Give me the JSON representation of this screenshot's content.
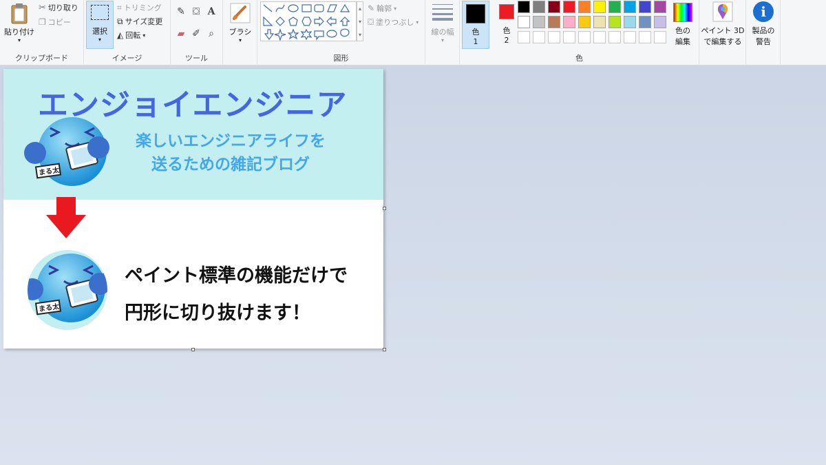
{
  "ribbon": {
    "clipboard": {
      "paste_label": "貼り付け",
      "cut_label": "切り取り",
      "copy_label": "コピー",
      "group_label": "クリップボード"
    },
    "image": {
      "select_label": "選択",
      "crop_label": "トリミング",
      "resize_label": "サイズ変更",
      "rotate_label": "回転",
      "group_label": "イメージ"
    },
    "tools": {
      "group_label": "ツール"
    },
    "brushes": {
      "label": "ブラシ"
    },
    "shapes": {
      "outline_label": "輪郭",
      "fill_label": "塗りつぶし",
      "group_label": "図形"
    },
    "size": {
      "label": "線の幅"
    },
    "colors": {
      "color1_label": "色",
      "color1_num": "1",
      "color2_label": "色",
      "color2_num": "2",
      "color1_value": "#000000",
      "color2_value": "#ed1c24",
      "edit_label_1": "色の",
      "edit_label_2": "編集",
      "group_label": "色",
      "palette_row1": [
        "#000000",
        "#7f7f7f",
        "#880015",
        "#ed1c24",
        "#ff7f27",
        "#fff200",
        "#22b14c",
        "#00a2e8",
        "#3f48cc",
        "#a349a4"
      ],
      "palette_row2": [
        "#ffffff",
        "#c3c3c3",
        "#b97a57",
        "#ffaec9",
        "#ffc90e",
        "#efe4b0",
        "#b5e61d",
        "#99d9ea",
        "#7092be",
        "#c8bfe7"
      ]
    },
    "paint3d": {
      "label_1": "ペイント 3D",
      "label_2": "で編集する"
    },
    "product_alert": {
      "label_1": "製品の",
      "label_2": "警告"
    }
  },
  "canvas": {
    "banner_title": "エンジョイエンジニア",
    "banner_sub_1": "楽しいエンジニアライフを",
    "banner_sub_2": "送るための雑記ブログ",
    "mascot_tag": "まる太",
    "body_line_1": "ペイント標準の機能だけで",
    "body_line_2": "円形に切り抜けます！"
  }
}
